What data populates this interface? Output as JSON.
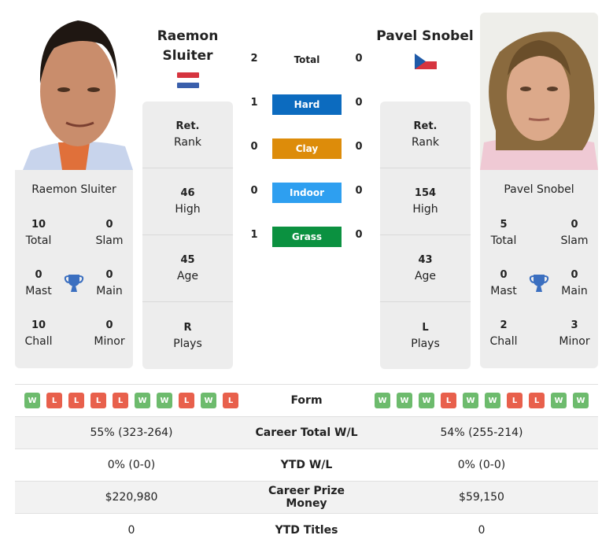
{
  "player1": {
    "name_line1": "Raemon",
    "name_line2": "Sluiter",
    "card_name": "Raemon Sluiter",
    "country": "Netherlands",
    "flag_icon": "netherlands-flag-icon",
    "titles": {
      "total": "10",
      "total_label": "Total",
      "slam": "0",
      "slam_label": "Slam",
      "mast": "0",
      "mast_label": "Mast",
      "main": "0",
      "main_label": "Main",
      "chall": "10",
      "chall_label": "Chall",
      "minor": "0",
      "minor_label": "Minor"
    },
    "info": {
      "rank": "Ret.",
      "rank_label": "Rank",
      "high": "46",
      "high_label": "High",
      "age": "45",
      "age_label": "Age",
      "plays": "R",
      "plays_label": "Plays"
    },
    "form": [
      "W",
      "L",
      "L",
      "L",
      "L",
      "W",
      "W",
      "L",
      "W",
      "L"
    ],
    "career_wl": "55% (323-264)",
    "ytd_wl": "0% (0-0)",
    "prize_money": "$220,980",
    "ytd_titles": "0"
  },
  "player2": {
    "name": "Pavel Snobel",
    "card_name": "Pavel Snobel",
    "country": "Czech Republic",
    "flag_icon": "czech-flag-icon",
    "titles": {
      "total": "5",
      "total_label": "Total",
      "slam": "0",
      "slam_label": "Slam",
      "mast": "0",
      "mast_label": "Mast",
      "main": "0",
      "main_label": "Main",
      "chall": "2",
      "chall_label": "Chall",
      "minor": "3",
      "minor_label": "Minor"
    },
    "info": {
      "rank": "Ret.",
      "rank_label": "Rank",
      "high": "154",
      "high_label": "High",
      "age": "43",
      "age_label": "Age",
      "plays": "L",
      "plays_label": "Plays"
    },
    "form": [
      "W",
      "W",
      "W",
      "L",
      "W",
      "W",
      "L",
      "L",
      "W",
      "W"
    ],
    "career_wl": "54% (255-214)",
    "ytd_wl": "0% (0-0)",
    "prize_money": "$59,150",
    "ytd_titles": "0"
  },
  "h2h": {
    "total_label": "Total",
    "total": {
      "p1": "2",
      "p2": "0"
    },
    "surfaces": [
      {
        "label": "Hard",
        "p1": "1",
        "p2": "0",
        "color": "#0c6bbf"
      },
      {
        "label": "Clay",
        "p1": "0",
        "p2": "0",
        "color": "#dd8c0a"
      },
      {
        "label": "Indoor",
        "p1": "0",
        "p2": "0",
        "color": "#2e9ff0"
      },
      {
        "label": "Grass",
        "p1": "1",
        "p2": "0",
        "color": "#0b9140"
      }
    ]
  },
  "table": {
    "form_label": "Form",
    "career_wl_label": "Career Total W/L",
    "ytd_wl_label": "YTD W/L",
    "prize_label": "Career Prize Money",
    "ytd_titles_label": "YTD Titles"
  },
  "colors": {
    "win": "#6dbb6d",
    "loss": "#e8604c",
    "trophy": "#3b6fc0",
    "card_bg": "#ededed"
  }
}
